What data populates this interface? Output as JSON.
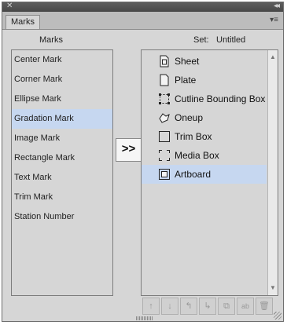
{
  "panel": {
    "tab_label": "Marks",
    "close_glyph": "✕",
    "collapse_glyph": "◂◂",
    "menu_glyph": "▾≡"
  },
  "left": {
    "header": "Marks",
    "items": [
      {
        "label": "Center Mark"
      },
      {
        "label": "Corner Mark"
      },
      {
        "label": "Ellipse Mark"
      },
      {
        "label": "Gradation Mark"
      },
      {
        "label": "Image Mark"
      },
      {
        "label": "Rectangle Mark"
      },
      {
        "label": "Text Mark"
      },
      {
        "label": "Trim Mark"
      },
      {
        "label": "Station Number"
      }
    ],
    "selected_index": 3
  },
  "transfer_button": {
    "label": ">>"
  },
  "right": {
    "set_label": "Set:",
    "set_value": "Untitled",
    "items": [
      {
        "label": "Sheet",
        "icon": "sheet-icon"
      },
      {
        "label": "Plate",
        "icon": "plate-icon"
      },
      {
        "label": "Cutline Bounding Box",
        "icon": "cutline-bounding-box-icon"
      },
      {
        "label": "Oneup",
        "icon": "oneup-icon"
      },
      {
        "label": "Trim Box",
        "icon": "trim-box-icon"
      },
      {
        "label": "Media Box",
        "icon": "media-box-icon"
      },
      {
        "label": "Artboard",
        "icon": "artboard-icon"
      }
    ],
    "selected_index": 6
  },
  "toolbar": {
    "buttons": [
      {
        "name": "move-up-icon",
        "glyph": "↑"
      },
      {
        "name": "move-down-icon",
        "glyph": "↓"
      },
      {
        "name": "move-out-icon",
        "glyph": "↰"
      },
      {
        "name": "move-in-icon",
        "glyph": "↳"
      },
      {
        "name": "duplicate-icon",
        "glyph": "⧉"
      },
      {
        "name": "find-replace-icon",
        "glyph": "ab"
      },
      {
        "name": "delete-icon",
        "glyph": "🗑"
      }
    ]
  },
  "colors": {
    "panel_bg": "#d6d6d6",
    "selection": "#c6d7f0",
    "titlebar": "#4f4f4f"
  }
}
